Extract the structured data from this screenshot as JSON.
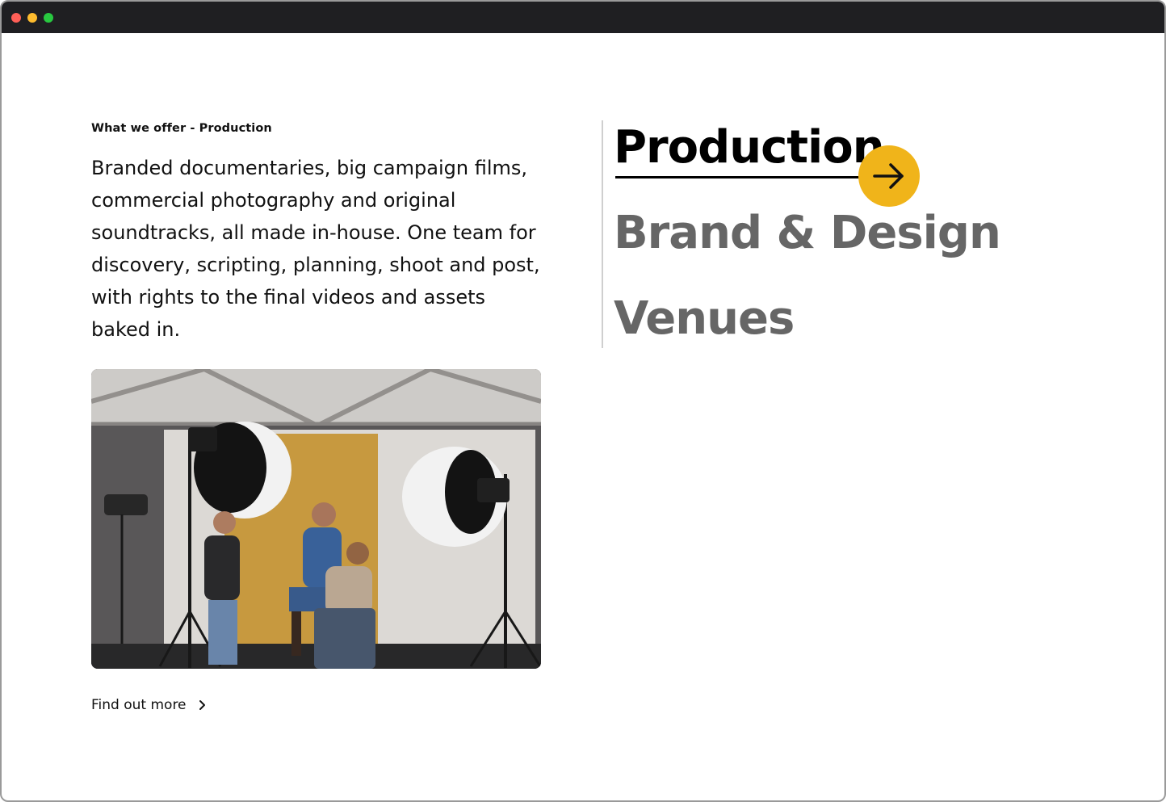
{
  "window": {
    "titlebar_color": "#1f1f22"
  },
  "section": {
    "eyebrow": "What we offer - Production",
    "intro": "Branded documentaries, big campaign films, commercial photography and original soundtracks, all made in-house. One team for discovery, scripting, planning, shoot and post, with rights to the final videos and assets baked in.",
    "image_alt": "Photo studio shoot with two softbox lights, a mustard backdrop and three crew members",
    "cta_label": "Find out more"
  },
  "services": {
    "items": [
      {
        "label": "Production",
        "active": true
      },
      {
        "label": "Brand & Design",
        "active": false
      },
      {
        "label": "Venues",
        "active": false
      }
    ],
    "active_color": "#000000",
    "inactive_color": "#666666",
    "arrow_button_color": "#f0b41a"
  },
  "icons": {
    "arrow": "arrow-right-icon",
    "chevron": "chevron-right-icon"
  }
}
